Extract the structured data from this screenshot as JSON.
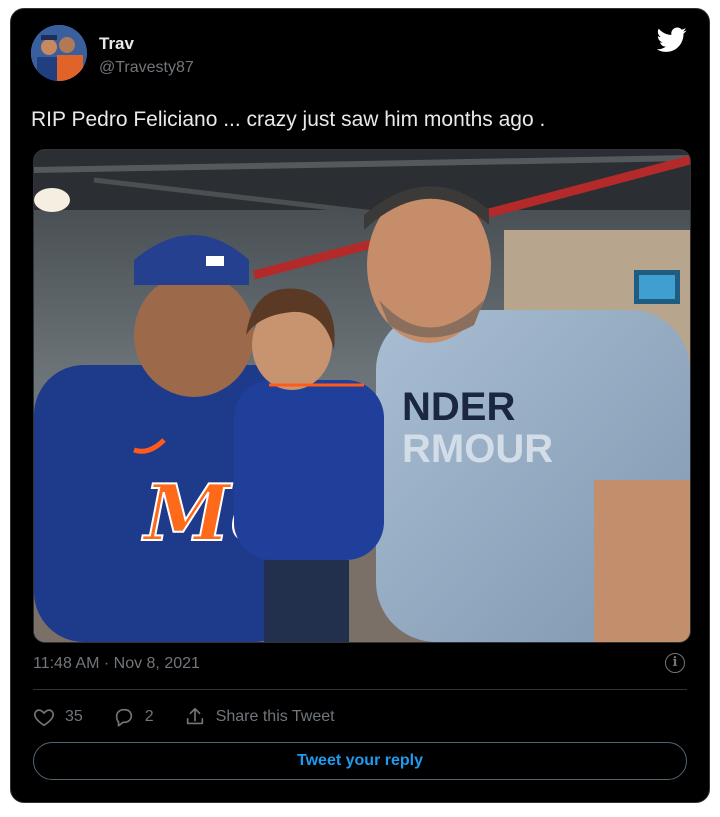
{
  "tweet": {
    "author_name": "Trav",
    "author_handle": "@Travesty87",
    "text": "RIP Pedro Feliciano ... crazy just saw him months ago .",
    "timestamp": "11:48 AM · Nov 8, 2021",
    "likes": "35",
    "replies": "2",
    "share_label": "Share this Tweet",
    "reply_button_label": "Tweet your reply",
    "info_glyph": "i",
    "shirt_text_line1": "NDER",
    "shirt_text_line2": "RMOUR",
    "jersey_text": "Me"
  },
  "colors": {
    "background": "#000000",
    "text_primary": "#e7e9ea",
    "text_secondary": "#71767b",
    "accent": "#1d9bf0",
    "border": "#2f3336"
  },
  "icons": {
    "logo": "twitter-bird-icon",
    "like": "heart-icon",
    "reply": "reply-bubble-icon",
    "share": "share-icon",
    "info": "info-icon"
  }
}
